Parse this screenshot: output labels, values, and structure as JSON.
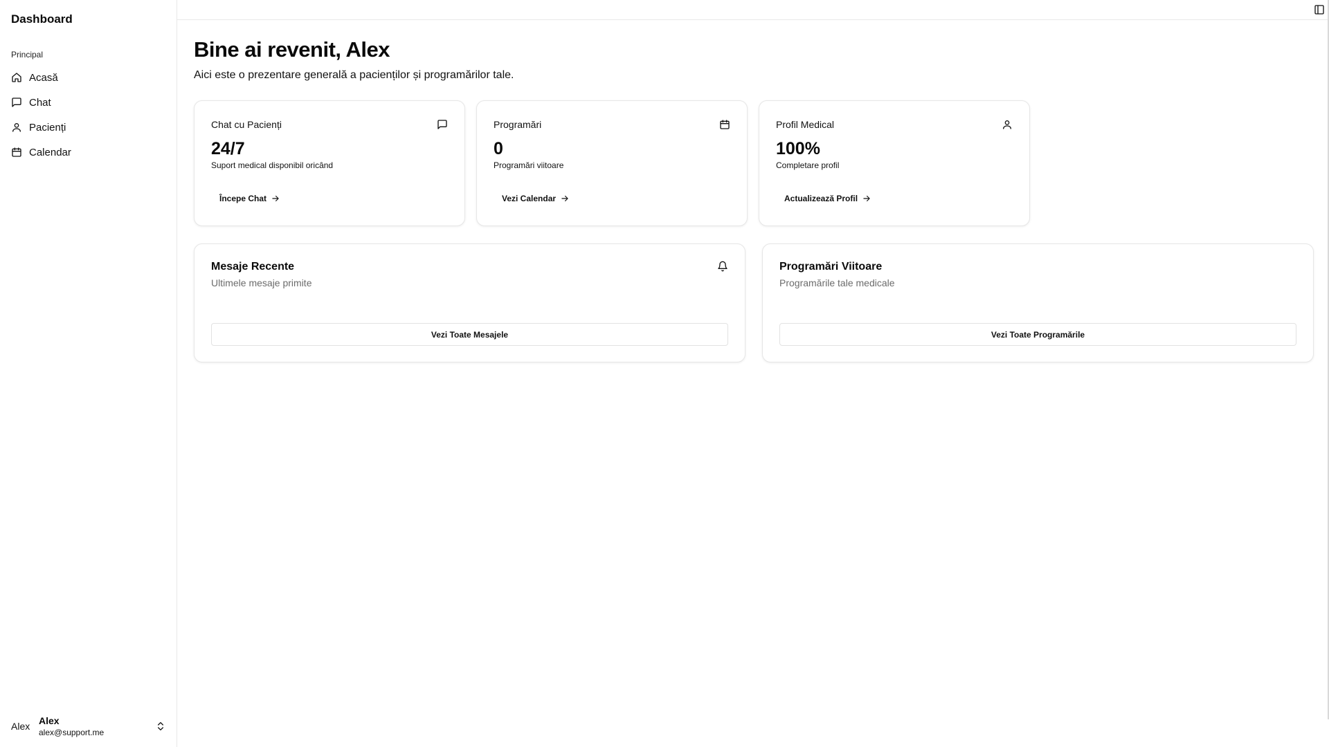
{
  "sidebar": {
    "brand": "Dashboard",
    "group_label": "Principal",
    "items": [
      {
        "label": "Acasă",
        "icon": "home-icon"
      },
      {
        "label": "Chat",
        "icon": "message-icon"
      },
      {
        "label": "Pacienți",
        "icon": "user-icon"
      },
      {
        "label": "Calendar",
        "icon": "calendar-icon"
      }
    ],
    "user": {
      "avatar": "Alex",
      "name": "Alex",
      "email": "alex@support.me"
    }
  },
  "main": {
    "title": "Bine ai revenit, Alex",
    "subtitle": "Aici este o prezentare generală a pacienților și programărilor tale.",
    "stat_cards": [
      {
        "label": "Chat cu Pacienți",
        "icon": "message-icon",
        "value": "24/7",
        "desc": "Suport medical disponibil oricând",
        "action": "Începe Chat"
      },
      {
        "label": "Programări",
        "icon": "calendar-icon",
        "value": "0",
        "desc": "Programări viitoare",
        "action": "Vezi Calendar"
      },
      {
        "label": "Profil Medical",
        "icon": "user-icon",
        "value": "100%",
        "desc": "Completare profil",
        "action": "Actualizează Profil"
      }
    ],
    "recent_messages": {
      "title": "Mesaje Recente",
      "subtitle": "Ultimele mesaje primite",
      "icon": "bell-icon",
      "button": "Vezi Toate Mesajele"
    },
    "upcoming": {
      "title": "Programări Viitoare",
      "subtitle": "Programările tale medicale",
      "button": "Vezi Toate Programările"
    }
  }
}
